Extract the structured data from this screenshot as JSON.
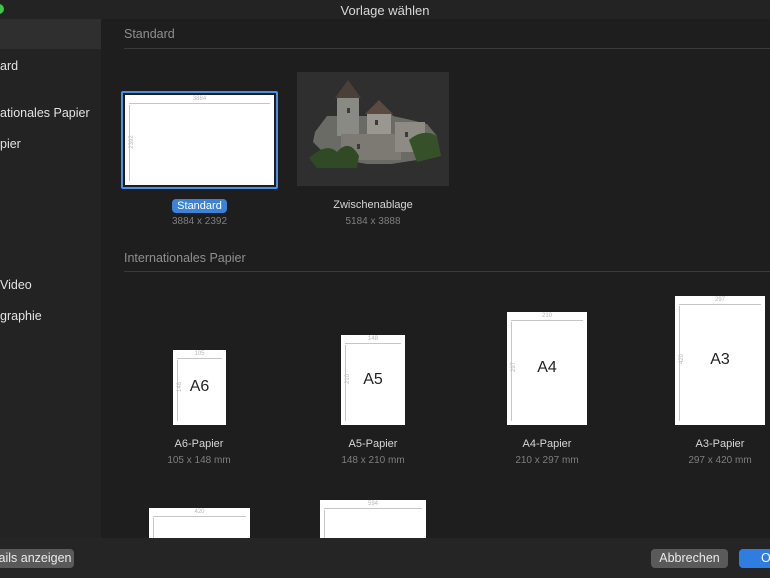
{
  "window": {
    "title": "Vorlage wählen"
  },
  "sidebar": {
    "items": [
      {
        "label": ""
      },
      {
        "label": "ard"
      },
      {
        "label": "ationales Papier"
      },
      {
        "label": "pier"
      },
      {
        "label": " Video"
      },
      {
        "label": "graphie"
      }
    ]
  },
  "sections": {
    "standard": {
      "title": "Standard"
    },
    "international": {
      "title": "Internationales Papier"
    }
  },
  "templates": {
    "standard": {
      "label": "Standard",
      "size": "3884 x 2392",
      "dim_w": "3884",
      "dim_h": "2392"
    },
    "clipboard": {
      "label": "Zwischenablage",
      "size": "5184 x 3888"
    },
    "a6": {
      "label": "A6-Papier",
      "size": "105 x 148 mm",
      "big": "A6",
      "dim_w": "105",
      "dim_h": "148"
    },
    "a5": {
      "label": "A5-Papier",
      "size": "148 x 210 mm",
      "big": "A5",
      "dim_w": "148",
      "dim_h": "210"
    },
    "a4": {
      "label": "A4-Papier",
      "size": "210 x 297 mm",
      "big": "A4",
      "dim_w": "210",
      "dim_h": "297"
    },
    "a3": {
      "label": "A3-Papier",
      "size": "297 x 420 mm",
      "big": "A3",
      "dim_w": "297",
      "dim_h": "420"
    },
    "a2": {
      "dim_w": "420"
    },
    "a1": {
      "dim_w": "594"
    }
  },
  "footer": {
    "details_label": "ails anzeigen",
    "cancel_label": "Abbrechen",
    "ok_label": "O"
  },
  "colors": {
    "accent": "#2f7de1",
    "selection_pill": "#3b82d9"
  }
}
